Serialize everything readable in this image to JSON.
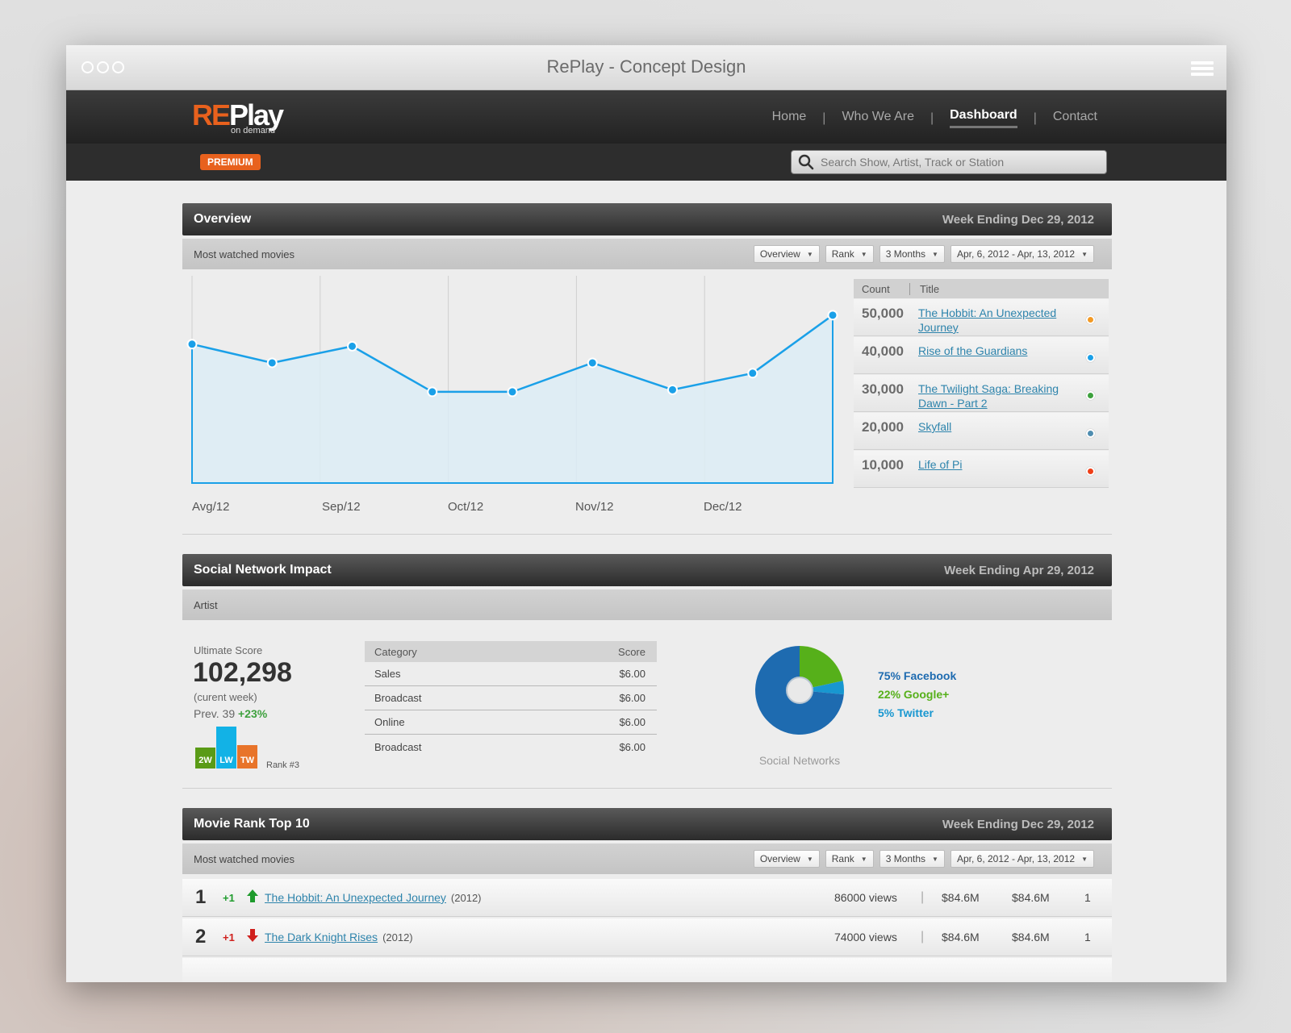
{
  "window": {
    "title": "RePlay - Concept Design"
  },
  "brand": {
    "logo_re": "RE",
    "logo_play": "Play",
    "logo_sub": "on demand",
    "badge": "PREMIUM",
    "accent": "#e8611d"
  },
  "nav": {
    "items": [
      {
        "label": "Home",
        "active": false
      },
      {
        "label": "Who We Are",
        "active": false
      },
      {
        "label": "Dashboard",
        "active": true
      },
      {
        "label": "Contact",
        "active": false
      }
    ],
    "separator": "|"
  },
  "search": {
    "placeholder": "Search Show, Artist, Track or Station",
    "icon": "search-icon"
  },
  "overview": {
    "title": "Overview",
    "week": "Week Ending Dec 29, 2012",
    "subtitle": "Most watched movies",
    "filters": [
      "Overview",
      "Rank",
      "3 Months",
      "Apr, 6, 2012 - Apr, 13, 2012"
    ],
    "x_labels": [
      "Avg/12",
      "Sep/12",
      "Oct/12",
      "Nov/12",
      "Dec/12"
    ],
    "table": {
      "headers": [
        "Count",
        "Title"
      ],
      "rows": [
        {
          "count": "50,000",
          "title": "The Hobbit: An Unexpected Journey",
          "color": "#f39a25"
        },
        {
          "count": "40,000",
          "title": "Rise of the Guardians",
          "color": "#1aa0e8"
        },
        {
          "count": "30,000",
          "title": "The Twilight Saga: Breaking Dawn - Part 2",
          "color": "#3ea13e"
        },
        {
          "count": "20,000",
          "title": "Skyfall",
          "color": "#4f8db0"
        },
        {
          "count": "10,000",
          "title": "Life of Pi",
          "color": "#ef3f18"
        }
      ]
    }
  },
  "chart_data": {
    "type": "area",
    "x": [
      "Avg/12",
      "Sep/12",
      "Oct/12",
      "Nov/12",
      "Dec/12"
    ],
    "series": [
      {
        "values": [
          0.67,
          0.58,
          0.66,
          0.44,
          0.44,
          0.58,
          0.45,
          0.53,
          0.81
        ]
      }
    ],
    "grid": true,
    "color": "#1aa0e8"
  },
  "social": {
    "title": "Social Network Impact",
    "week": "Week Ending Apr 29, 2012",
    "subtitle": "Artist",
    "score_label": "Ultimate Score",
    "score": "102,298",
    "score_note": "(curent week)",
    "prev": "Prev. 39",
    "prev_change": "+23%",
    "bars": [
      {
        "label": "2W",
        "value": 0.5,
        "color": "#5a9b16"
      },
      {
        "label": "LW",
        "value": 1.0,
        "color": "#12b2e6"
      },
      {
        "label": "TW",
        "value": 0.55,
        "color": "#e8742a"
      }
    ],
    "rank": "Rank #3",
    "categories": {
      "headers": [
        "Category",
        "Score"
      ],
      "rows": [
        {
          "category": "Sales",
          "score": "$6.00"
        },
        {
          "category": "Broadcast",
          "score": "$6.00"
        },
        {
          "category": "Online",
          "score": "$6.00"
        },
        {
          "category": "Broadcast",
          "score": "$6.00"
        }
      ]
    },
    "pie_title": "Social Networks",
    "networks": [
      {
        "label": "75% Facebook",
        "value": 75,
        "color": "#1e6bb0"
      },
      {
        "label": "22% Google+",
        "value": 22,
        "color": "#56b01a"
      },
      {
        "label": "5% Twitter",
        "value": 5,
        "color": "#1897d0"
      }
    ]
  },
  "rank_top": {
    "title": "Movie Rank Top 10",
    "week": "Week Ending Dec 29, 2012",
    "subtitle": "Most watched movies",
    "filters": [
      "Overview",
      "Rank",
      "3 Months",
      "Apr, 6, 2012 - Apr, 13, 2012"
    ],
    "rows": [
      {
        "rank": "1",
        "change": "+1",
        "direction": "up",
        "title": "The Hobbit: An Unexpected Journey",
        "year": "(2012)",
        "views": "86000 views",
        "m1": "$84.6M",
        "m2": "$84.6M",
        "r": "1",
        "color": "#1e9b2c"
      },
      {
        "rank": "2",
        "change": "+1",
        "direction": "down",
        "title": "The Dark Knight Rises",
        "year": "(2012)",
        "views": "74000 views",
        "m1": "$84.6M",
        "m2": "$84.6M",
        "r": "1",
        "color": "#d0201d"
      }
    ]
  }
}
